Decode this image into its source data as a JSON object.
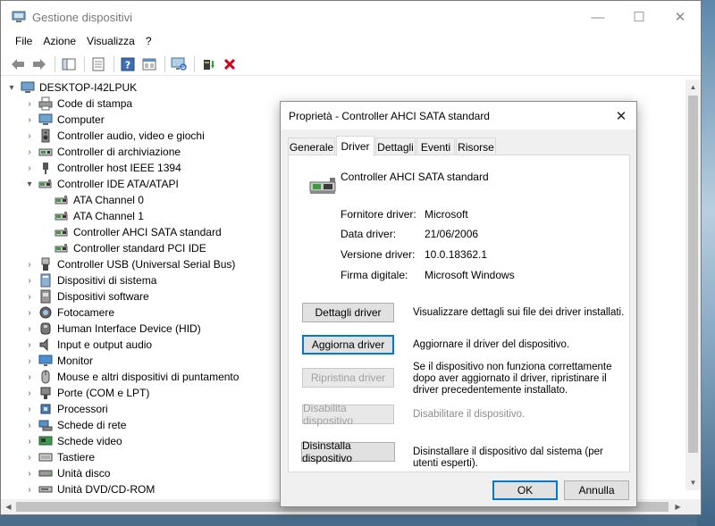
{
  "window": {
    "title": "Gestione dispositivi",
    "controls": {
      "minimize": "—",
      "maximize": "☐",
      "close": "✕"
    }
  },
  "menu": [
    "File",
    "Azione",
    "Visualizza",
    "?"
  ],
  "toolbar": {
    "icons": [
      "back-arrow-icon",
      "forward-arrow-icon",
      "show-hide-tree-icon",
      "properties-icon",
      "help-icon",
      "view-icon",
      "monitor-scan-icon",
      "update-driver-icon",
      "uninstall-x-icon"
    ],
    "uninstall_color": "#d0021b"
  },
  "tree": {
    "root": "DESKTOP-I42LPUK",
    "items": [
      {
        "label": "Code di stampa",
        "icon": "printer-icon",
        "expanded": false
      },
      {
        "label": "Computer",
        "icon": "computer-icon",
        "expanded": false
      },
      {
        "label": "Controller audio, video e giochi",
        "icon": "speaker-icon",
        "expanded": false
      },
      {
        "label": "Controller di archiviazione",
        "icon": "storage-controller-icon",
        "expanded": false
      },
      {
        "label": "Controller host IEEE 1394",
        "icon": "firewire-icon",
        "expanded": false
      },
      {
        "label": "Controller IDE ATA/ATAPI",
        "icon": "ide-controller-icon",
        "expanded": true
      },
      {
        "label": "ATA Channel 0",
        "icon": "ide-controller-icon",
        "child": true
      },
      {
        "label": "ATA Channel 1",
        "icon": "ide-controller-icon",
        "child": true
      },
      {
        "label": "Controller AHCI SATA standard",
        "icon": "ide-controller-icon",
        "child": true
      },
      {
        "label": "Controller standard PCI IDE",
        "icon": "ide-controller-icon",
        "child": true
      },
      {
        "label": "Controller USB (Universal Serial Bus)",
        "icon": "usb-icon",
        "expanded": false
      },
      {
        "label": "Dispositivi di sistema",
        "icon": "system-devices-icon",
        "expanded": false
      },
      {
        "label": "Dispositivi software",
        "icon": "software-device-icon",
        "expanded": false
      },
      {
        "label": "Fotocamere",
        "icon": "camera-icon",
        "expanded": false
      },
      {
        "label": "Human Interface Device (HID)",
        "icon": "hid-icon",
        "expanded": false
      },
      {
        "label": "Input e output audio",
        "icon": "audio-io-icon",
        "expanded": false
      },
      {
        "label": "Monitor",
        "icon": "monitor-icon",
        "expanded": false
      },
      {
        "label": "Mouse e altri dispositivi di puntamento",
        "icon": "mouse-icon",
        "expanded": false
      },
      {
        "label": "Porte (COM e LPT)",
        "icon": "port-icon",
        "expanded": false
      },
      {
        "label": "Processori",
        "icon": "processor-icon",
        "expanded": false
      },
      {
        "label": "Schede di rete",
        "icon": "network-adapter-icon",
        "expanded": false
      },
      {
        "label": "Schede video",
        "icon": "display-adapter-icon",
        "expanded": false
      },
      {
        "label": "Tastiere",
        "icon": "keyboard-icon",
        "expanded": false
      },
      {
        "label": "Unità disco",
        "icon": "disk-drive-icon",
        "expanded": false
      },
      {
        "label": "Unità DVD/CD-ROM",
        "icon": "dvd-drive-icon",
        "expanded": false
      }
    ]
  },
  "dialog": {
    "title": "Proprietà - Controller AHCI SATA standard",
    "close": "✕",
    "tabs": [
      "Generale",
      "Driver",
      "Dettagli",
      "Eventi",
      "Risorse"
    ],
    "active_tab": "Driver",
    "device_name": "Controller AHCI SATA standard",
    "properties": [
      {
        "label": "Fornitore driver:",
        "value": "Microsoft"
      },
      {
        "label": "Data driver:",
        "value": "21/06/2006"
      },
      {
        "label": "Versione driver:",
        "value": "10.0.18362.1"
      },
      {
        "label": "Firma digitale:",
        "value": "Microsoft Windows"
      }
    ],
    "actions": [
      {
        "button": "Dettagli driver",
        "desc": "Visualizzare dettagli sui file dei driver installati.",
        "enabled": true
      },
      {
        "button": "Aggiorna driver",
        "desc": "Aggiornare il driver del dispositivo.",
        "enabled": true,
        "focused": true
      },
      {
        "button": "Ripristina driver",
        "desc": "Se il dispositivo non funziona correttamente dopo aver aggiornato il driver, ripristinare il driver precedentemente installato.",
        "enabled": false
      },
      {
        "button": "Disabilita dispositivo",
        "desc": "Disabilitare il dispositivo.",
        "enabled": false
      },
      {
        "button": "Disinstalla dispositivo",
        "desc": "Disinstallare il dispositivo dal sistema (per utenti esperti).",
        "enabled": true
      }
    ],
    "ok_label": "OK",
    "cancel_label": "Annulla"
  }
}
